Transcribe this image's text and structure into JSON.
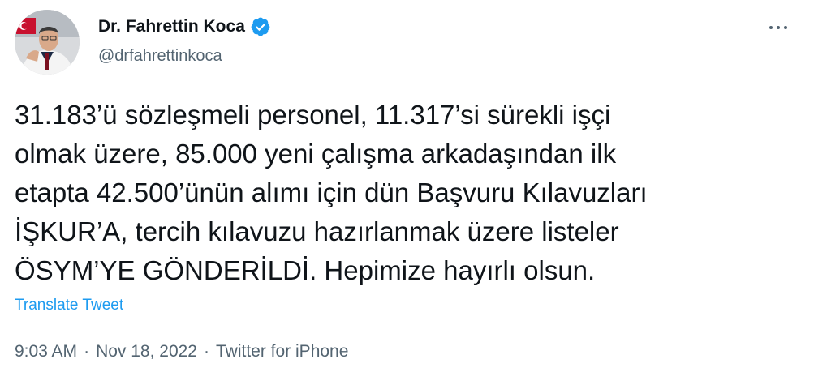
{
  "author": {
    "display_name": "Dr. Fahrettin Koca",
    "handle": "@drfahrettinkoca",
    "verified": true,
    "avatar_icon": "profile-photo"
  },
  "more_icon": "ellipsis-icon",
  "tweet": {
    "lines": [
      "31.183’ü sözleşmeli personel, 11.317’si sürekli işçi",
      "olmak üzere, 85.000 yeni çalışma arkadaşından ilk",
      "etapta 42.500’ünün alımı için dün Başvuru Kılavuzları",
      "İŞKUR’A, tercih kılavuzu hazırlanmak üzere listeler",
      "ÖSYM’YE GÖNDERİLDİ. Hepimize hayırlı olsun."
    ]
  },
  "translate_label": "Translate Tweet",
  "meta": {
    "time": "9:03 AM",
    "separator": "·",
    "date": "Nov 18, 2022",
    "source": "Twitter for iPhone"
  },
  "colors": {
    "accent": "#1d9bf0",
    "secondary_text": "#536471",
    "primary_text": "#0f1419"
  }
}
